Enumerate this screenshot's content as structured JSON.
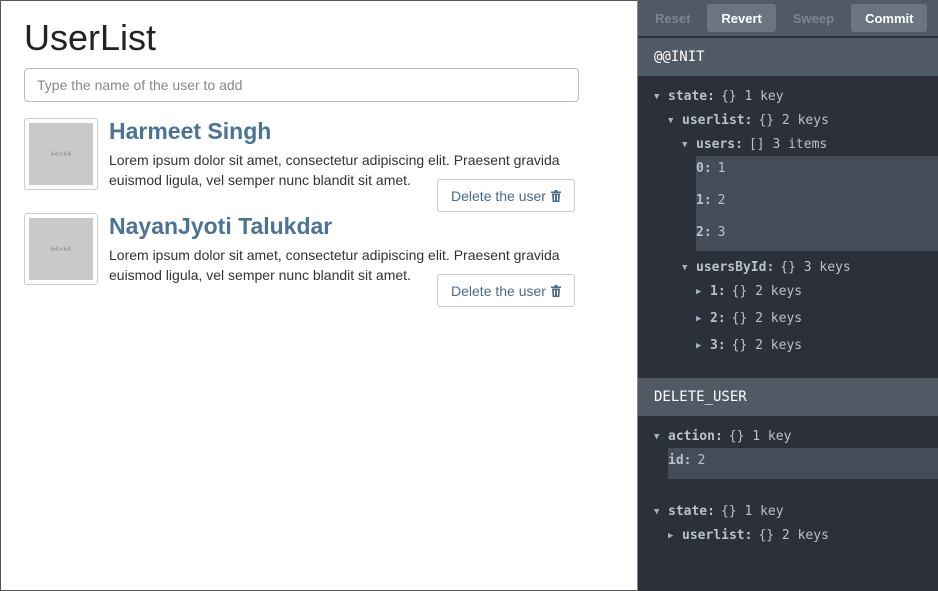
{
  "app": {
    "title": "UserList",
    "add_placeholder": "Type the name of the user to add",
    "users": [
      {
        "thumb_label": "64×64",
        "name": "Harmeet Singh",
        "description": "Lorem ipsum dolor sit amet, consectetur adipiscing elit. Praesent gravida euismod ligula, vel semper nunc blandit sit amet.",
        "delete_label": "Delete the user"
      },
      {
        "thumb_label": "64×64",
        "name": "NayanJyoti Talukdar",
        "description": "Lorem ipsum dolor sit amet, consectetur adipiscing elit. Praesent gravida euismod ligula, vel semper nunc blandit sit amet.",
        "delete_label": "Delete the user"
      }
    ]
  },
  "devtools": {
    "toolbar": {
      "reset": "Reset",
      "revert": "Revert",
      "sweep": "Sweep",
      "commit": "Commit"
    },
    "init_action": {
      "title": "@@INIT",
      "state_key": "state:",
      "state_summary": "{} 1 key",
      "userlist_key": "userlist:",
      "userlist_summary": "{} 2 keys",
      "users_key": "users:",
      "users_summary": "[] 3 items",
      "users_items": [
        {
          "key": "0:",
          "value": "1"
        },
        {
          "key": "1:",
          "value": "2"
        },
        {
          "key": "2:",
          "value": "3"
        }
      ],
      "usersbyid_key": "usersById:",
      "usersbyid_summary": "{} 3 keys",
      "usersbyid_items": [
        {
          "key": "1:",
          "summary": "{} 2 keys"
        },
        {
          "key": "2:",
          "summary": "{} 2 keys"
        },
        {
          "key": "3:",
          "summary": "{} 2 keys"
        }
      ]
    },
    "delete_action": {
      "title": "DELETE_USER",
      "action_key": "action:",
      "action_summary": "{} 1 key",
      "id_key": "id:",
      "id_value": "2",
      "state_key": "state:",
      "state_summary": "{} 1 key",
      "userlist_key": "userlist:",
      "userlist_summary": "{} 2 keys"
    }
  }
}
